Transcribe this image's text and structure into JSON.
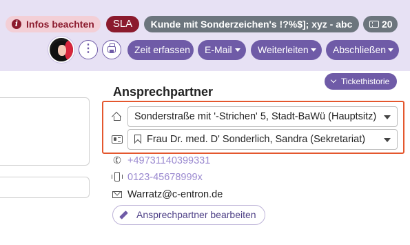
{
  "header": {
    "badges": {
      "infos": "Infos beachten",
      "sla": "SLA",
      "customer": "Kunde mit Sonderzeichen's !?%$]; xyz - abc",
      "ticket_count": "20"
    },
    "actions": {
      "more": "⋮",
      "time": "Zeit erfassen",
      "email": "E-Mail",
      "forward": "Weiterleiten",
      "close": "Abschließen"
    }
  },
  "main": {
    "ticket_history": "Tickethistorie",
    "section_title": "Ansprechpartner",
    "address_select": "Sonderstraße mit '-Strichen' 5, Stadt-BaWü (Hauptsitz)",
    "person_select": "Frau Dr. med. D' Sonderlich, Sandra (Sekretariat)",
    "phone": "+49731140399331",
    "mobile": "0123-45678999x",
    "email": "Warratz@c-entron.de",
    "edit_button": "Ansprechpartner bearbeiten"
  },
  "colors": {
    "header_bg": "#e7e1f4",
    "primary": "#6f5ba7",
    "danger": "#8b1a2d",
    "danger_light": "#f3cfd6",
    "gray_badge": "#6c757d",
    "link": "#9b8ad0",
    "highlight": "#e4572e"
  },
  "icons": [
    "info-icon",
    "ticket-icon",
    "avatar",
    "more-icon",
    "printer-icon",
    "chevron-down-icon",
    "home-icon",
    "id-card-icon",
    "bookmark-icon",
    "phone-icon",
    "mobile-icon",
    "mail-icon",
    "pencil-icon"
  ]
}
